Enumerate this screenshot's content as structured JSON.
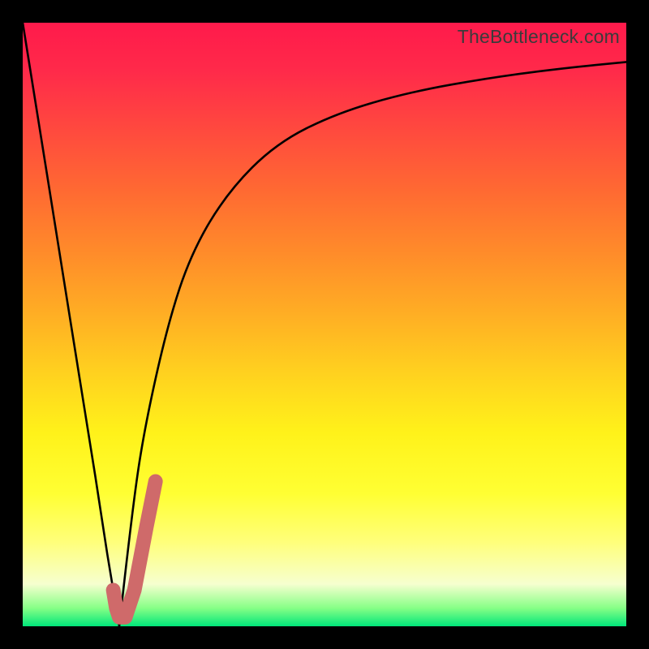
{
  "watermark": "TheBottleneck.com",
  "colors": {
    "curve_stroke": "#000000",
    "marker_stroke": "#cf6a6a",
    "background_black": "#000000"
  },
  "chart_data": {
    "type": "line",
    "title": "",
    "xlabel": "",
    "ylabel": "",
    "xlim": [
      0,
      100
    ],
    "ylim": [
      0,
      100
    ],
    "series": [
      {
        "name": "left-curve",
        "x": [
          0,
          4,
          8,
          12,
          14,
          16
        ],
        "values": [
          100,
          75,
          50,
          25,
          12,
          0
        ]
      },
      {
        "name": "right-curve",
        "x": [
          16,
          18,
          20,
          24,
          28,
          34,
          42,
          52,
          64,
          78,
          90,
          100
        ],
        "values": [
          0,
          18,
          32,
          50,
          62,
          72,
          80,
          85,
          88.5,
          91,
          92.5,
          93.5
        ]
      }
    ],
    "marker": {
      "name": "highlight-j",
      "points_xy": [
        [
          15.0,
          6.0
        ],
        [
          15.5,
          3.0
        ],
        [
          16.0,
          1.5
        ],
        [
          17.0,
          1.5
        ],
        [
          18.5,
          6.0
        ],
        [
          20.5,
          16.5
        ],
        [
          22.0,
          24.0
        ]
      ],
      "stroke_width_pct": 2.4
    }
  }
}
